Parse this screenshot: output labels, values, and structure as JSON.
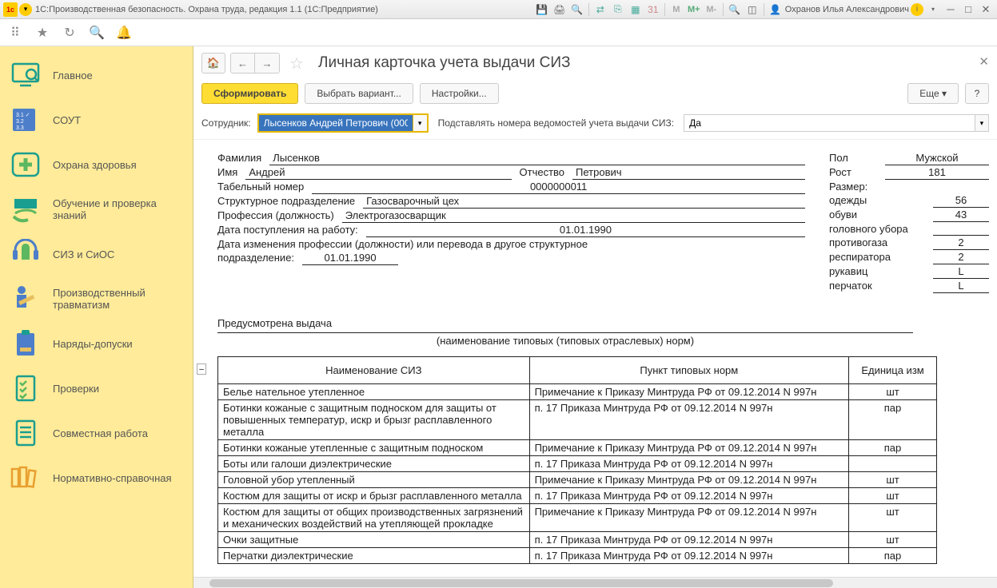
{
  "titlebar": {
    "app_title": "1С:Производственная безопасность. Охрана труда, редакция 1.1  (1С:Предприятие)",
    "user": "Охранов Илья Александрович"
  },
  "sidebar": {
    "items": [
      {
        "label": "Главное"
      },
      {
        "label": "СОУТ"
      },
      {
        "label": "Охрана здоровья"
      },
      {
        "label": "Обучение и проверка знаний"
      },
      {
        "label": "СИЗ и СиОС"
      },
      {
        "label": "Производственный травматизм"
      },
      {
        "label": "Наряды-допуски"
      },
      {
        "label": "Проверки"
      },
      {
        "label": "Совместная работа"
      },
      {
        "label": "Нормативно-справочная"
      }
    ]
  },
  "page": {
    "title": "Личная карточка учета выдачи СИЗ",
    "btn_form": "Сформировать",
    "btn_variant": "Выбрать вариант...",
    "btn_settings": "Настройки...",
    "btn_more": "Еще",
    "btn_help": "?"
  },
  "filter": {
    "employee_label": "Сотрудник:",
    "employee_value": "Лысенков Андрей Петрович (000",
    "substitute_label": "Подставлять номера ведомостей учета выдачи СИЗ:",
    "substitute_value": "Да"
  },
  "person": {
    "lastname_k": "Фамилия",
    "lastname_v": "Лысенков",
    "firstname_k": "Имя",
    "firstname_v": "Андрей",
    "patronymic_k": "Отчество",
    "patronymic_v": "Петрович",
    "tabnum_k": "Табельный номер",
    "tabnum_v": "0000000011",
    "dept_k": "Структурное подразделение",
    "dept_v": "Газосварочный цех",
    "prof_k": "Профессия (должность)",
    "prof_v": "Электрогазосварщик",
    "hiredate_k": "Дата поступления на работу:",
    "hiredate_v": "01.01.1990",
    "changedate_k1": "Дата изменения профессии (должности) или перевода в другое структурное",
    "changedate_k2": "подразделение:",
    "changedate_v": "01.01.1990",
    "sex_k": "Пол",
    "sex_v": "Мужской",
    "height_k": "Рост",
    "height_v": "181",
    "size_k": "Размер:",
    "clothes_k": "одежды",
    "clothes_v": "56",
    "shoes_k": "обуви",
    "shoes_v": "43",
    "head_k": "головного убора",
    "head_v": "",
    "gasmask_k": "противогаза",
    "gasmask_v": "2",
    "resp_k": "респиратора",
    "resp_v": "2",
    "mittens_k": "рукавиц",
    "mittens_v": "L",
    "gloves_k": "перчаток",
    "gloves_v": "L"
  },
  "norms": {
    "section_label": "Предусмотрена выдача",
    "caption": "(наименование типовых (типовых отраслевых) норм)"
  },
  "table": {
    "h1": "Наименование СИЗ",
    "h2": "Пункт типовых норм",
    "h3": "Единица изм",
    "rows": [
      {
        "name": "Белье нательное утепленное",
        "norm": "Примечание к Приказу Минтруда РФ от 09.12.2014 N 997н",
        "unit": "шт"
      },
      {
        "name": "Ботинки кожаные с защитным подноском для защиты от повышенных температур, искр и брызг расплавленного металла",
        "norm": "п. 17 Приказа Минтруда РФ от 09.12.2014 N 997н",
        "unit": "пар"
      },
      {
        "name": "Ботинки кожаные утепленные с защитным подноском",
        "norm": "Примечание к Приказу Минтруда РФ от 09.12.2014 N 997н",
        "unit": "пар"
      },
      {
        "name": "Боты или галоши диэлектрические",
        "norm": "п. 17 Приказа Минтруда РФ от 09.12.2014 N 997н",
        "unit": ""
      },
      {
        "name": "Головной убор утепленный",
        "norm": "Примечание к Приказу Минтруда РФ от 09.12.2014 N 997н",
        "unit": "шт"
      },
      {
        "name": "Костюм для защиты от искр и брызг расплавленного металла",
        "norm": "п. 17 Приказа Минтруда РФ от 09.12.2014 N 997н",
        "unit": "шт"
      },
      {
        "name": "Костюм для защиты от общих производственных загрязнений и механических воздействий на утепляющей прокладке",
        "norm": "Примечание к Приказу Минтруда РФ от 09.12.2014 N 997н",
        "unit": "шт"
      },
      {
        "name": "Очки защитные",
        "norm": "п. 17 Приказа Минтруда РФ от 09.12.2014 N 997н",
        "unit": "шт"
      },
      {
        "name": "Перчатки диэлектрические",
        "norm": "п. 17 Приказа Минтруда РФ от 09.12.2014 N 997н",
        "unit": "пар"
      }
    ]
  }
}
